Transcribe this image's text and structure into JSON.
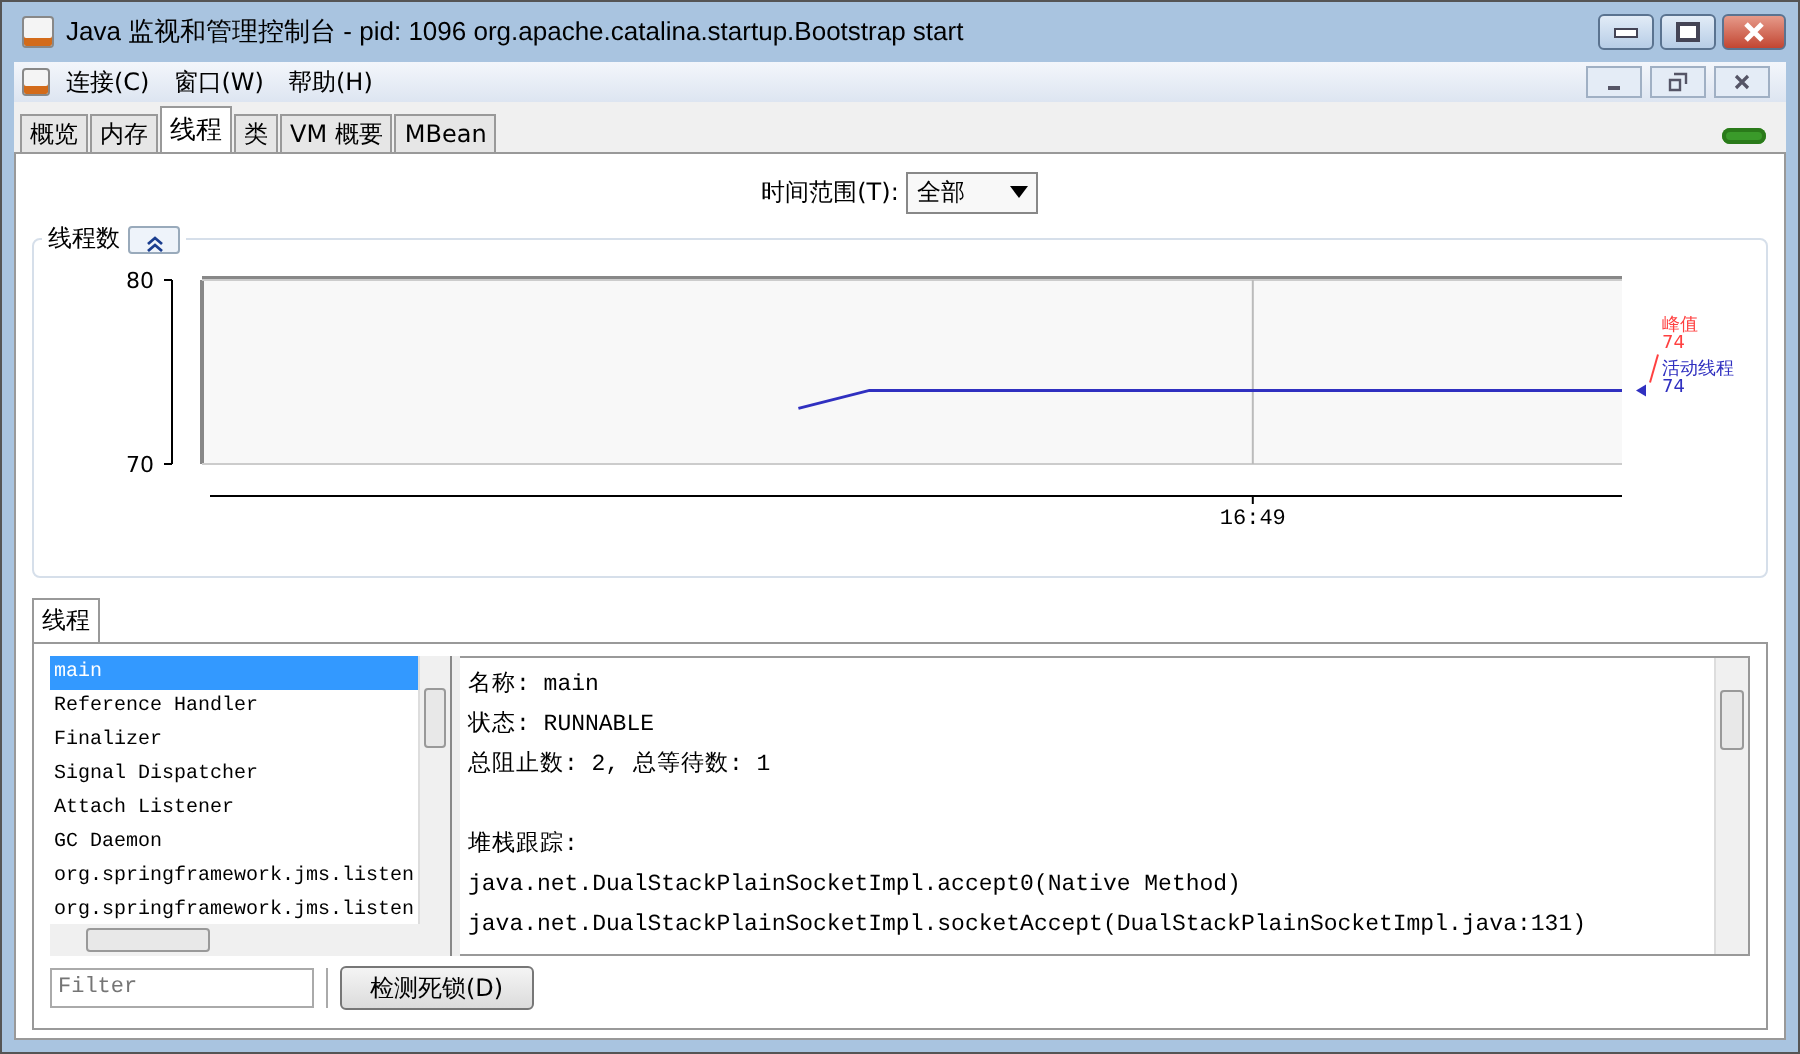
{
  "window": {
    "title": "Java 监视和管理控制台 - pid: 1096 org.apache.catalina.startup.Bootstrap start"
  },
  "menu": [
    "连接(C)",
    "窗口(W)",
    "帮助(H)"
  ],
  "tabs": [
    {
      "label": "概览",
      "selected": false
    },
    {
      "label": "内存",
      "selected": false
    },
    {
      "label": "线程",
      "selected": true
    },
    {
      "label": "类",
      "selected": false
    },
    {
      "label": "VM 概要",
      "selected": false
    },
    {
      "label": "MBean",
      "selected": false
    }
  ],
  "time_range": {
    "label": "时间范围(T):",
    "value": "全部"
  },
  "threads_chart": {
    "title": "线程数",
    "y_axis_labels": [
      "80",
      "70"
    ],
    "x_axis_label": "16:49",
    "legend": [
      {
        "label": "峰值",
        "value": "74",
        "color": "#ff4040"
      },
      {
        "label": "活动线程",
        "value": "74",
        "color": "#3030c0"
      }
    ]
  },
  "threads_panel": {
    "tab": "线程",
    "threads": [
      {
        "name": "main",
        "selected": true
      },
      {
        "name": "Reference Handler",
        "selected": false
      },
      {
        "name": "Finalizer",
        "selected": false
      },
      {
        "name": "Signal Dispatcher",
        "selected": false
      },
      {
        "name": "Attach Listener",
        "selected": false
      },
      {
        "name": "GC Daemon",
        "selected": false
      },
      {
        "name": "org.springframework.jms.listen",
        "selected": false
      },
      {
        "name": "org.springframework.jms.listen",
        "selected": false
      }
    ],
    "details": [
      [
        "名称: main",
        "状态: RUNNABLE",
        "总阻止数: 2, 总等待数: 1"
      ],
      [
        "堆栈跟踪:",
        "java.net.DualStackPlainSocketImpl.accept0(Native Method)",
        "java.net.DualStackPlainSocketImpl.socketAccept(DualStackPlainSocketImpl.java:131)"
      ]
    ],
    "filter": {
      "placeholder": "Filter"
    },
    "detect_button": "检测死锁(D)"
  }
}
